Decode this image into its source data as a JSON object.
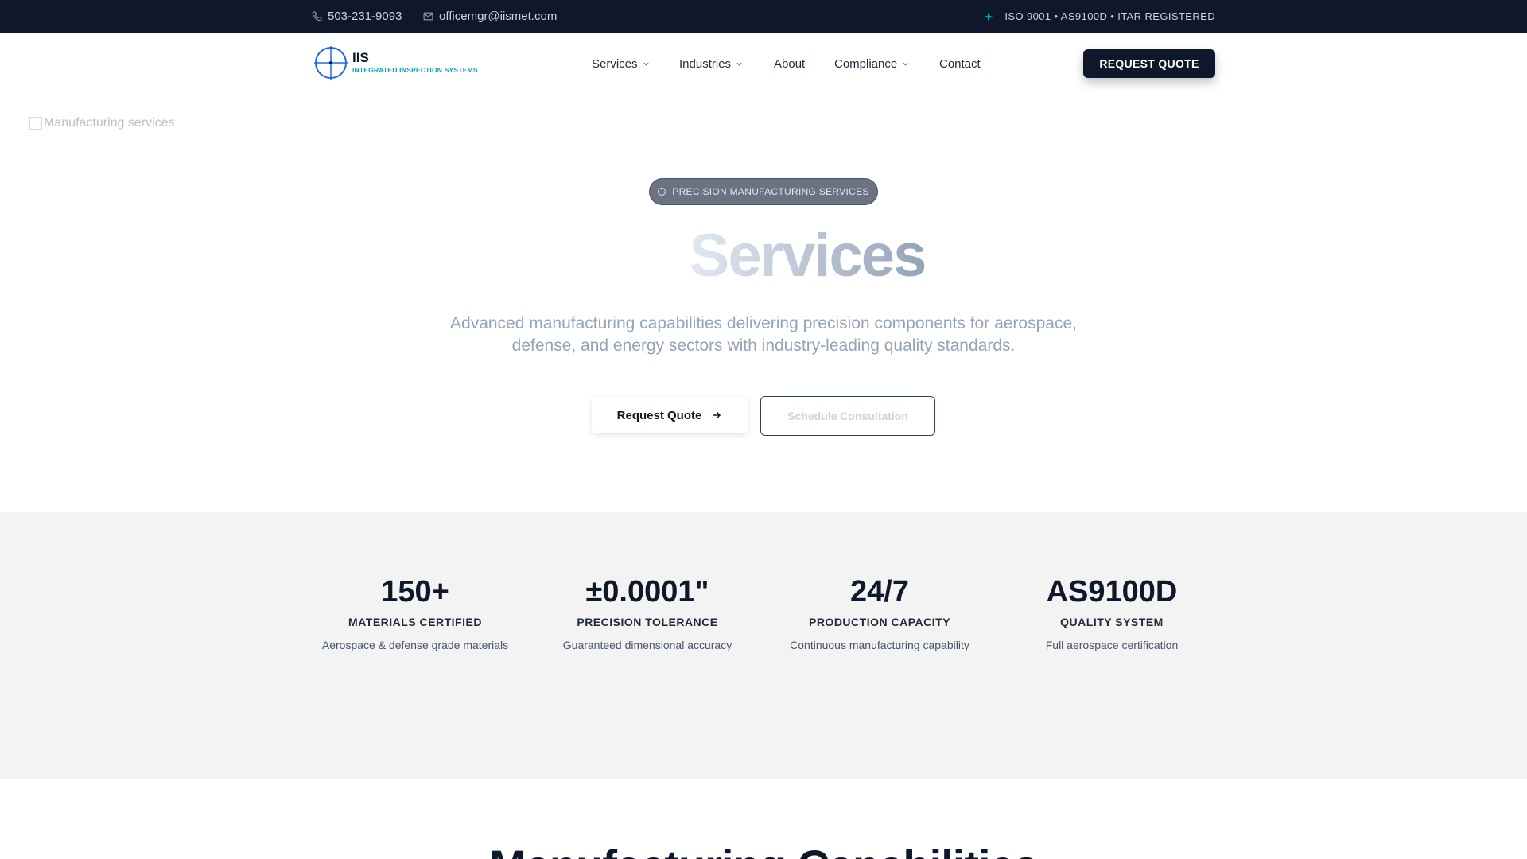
{
  "topbar": {
    "phone": "503-231-9093",
    "email": "officemgr@iismet.com",
    "certifications": "ISO 9001 • AS9100D • ITAR REGISTERED"
  },
  "header": {
    "logo_name": "IIS",
    "logo_sub": "INTEGRATED INSPECTION SYSTEMS",
    "nav": [
      {
        "label": "Services"
      },
      {
        "label": "Industries"
      },
      {
        "label": "About"
      },
      {
        "label": "Compliance"
      },
      {
        "label": "Contact"
      }
    ],
    "cta": "REQUEST QUOTE"
  },
  "hero": {
    "image_alt": "Manufacturing services",
    "badge": "PRECISION MANUFACTURING SERVICES",
    "title": "Services",
    "description": "Advanced manufacturing capabilities delivering precision components for aerospace, defense, and energy sectors with industry-leading quality standards.",
    "primary_button": "Request Quote",
    "secondary_button": "Schedule Consultation"
  },
  "stats": [
    {
      "value": "150+",
      "label": "MATERIALS CERTIFIED",
      "desc": "Aerospace & defense grade materials"
    },
    {
      "value": "±0.0001\"",
      "label": "PRECISION TOLERANCE",
      "desc": "Guaranteed dimensional accuracy"
    },
    {
      "value": "24/7",
      "label": "PRODUCTION CAPACITY",
      "desc": "Continuous manufacturing capability"
    },
    {
      "value": "AS9100D",
      "label": "QUALITY SYSTEM",
      "desc": "Full aerospace certification"
    }
  ],
  "capabilities": {
    "heading": "Manufacturing Capabilities"
  },
  "colors": {
    "navy": "#0f172a",
    "teal": "#0ea5b7",
    "logo_blue": "#2563eb"
  }
}
